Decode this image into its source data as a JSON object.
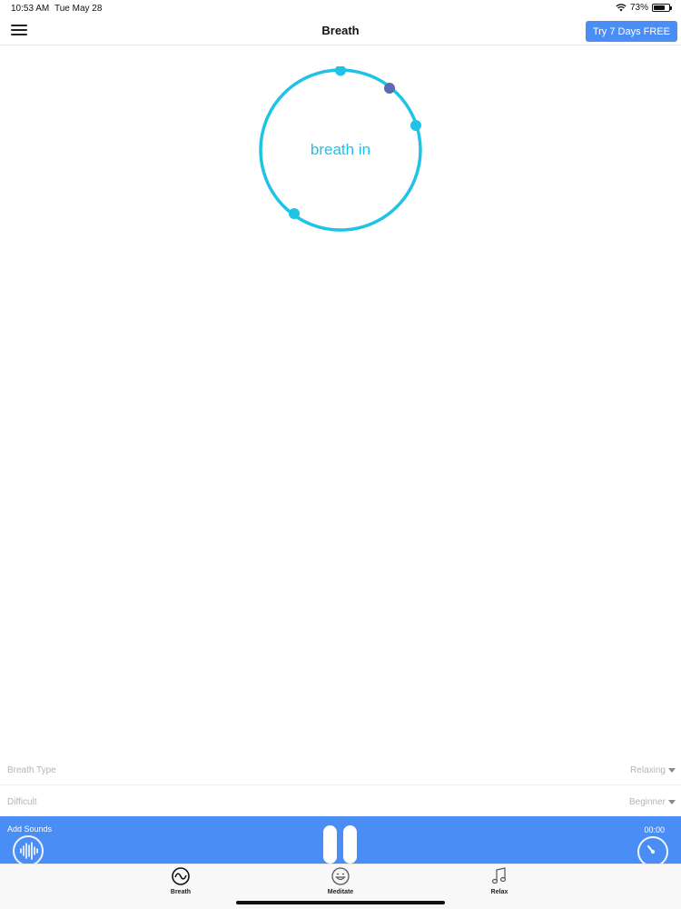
{
  "status_bar": {
    "time": "10:53 AM",
    "date": "Tue May 28",
    "battery_percent": "73%",
    "battery_level": 0.73
  },
  "nav": {
    "title": "Breath",
    "trial_label": "Try 7 Days FREE",
    "menu_icon": "hamburger-menu-icon"
  },
  "breath": {
    "instruction": "breath in",
    "ring_color": "#1ec3e6",
    "active_dot_color": "#5b6bb3"
  },
  "options": {
    "breath_type": {
      "label": "Breath Type",
      "value": "Relaxing"
    },
    "difficulty": {
      "label": "Difficult",
      "value": "Beginner"
    }
  },
  "player": {
    "add_sounds_label": "Add Sounds",
    "timer": "00:00",
    "bar_color": "#4a8ef5",
    "sound_icon": "waveform-icon",
    "pause_icon": "pause-icon",
    "timer_icon": "stopwatch-icon"
  },
  "tabs": [
    {
      "label": "Breath",
      "icon": "breath-wave-icon"
    },
    {
      "label": "Meditate",
      "icon": "smiley-face-icon"
    },
    {
      "label": "Relax",
      "icon": "music-note-icon"
    }
  ]
}
